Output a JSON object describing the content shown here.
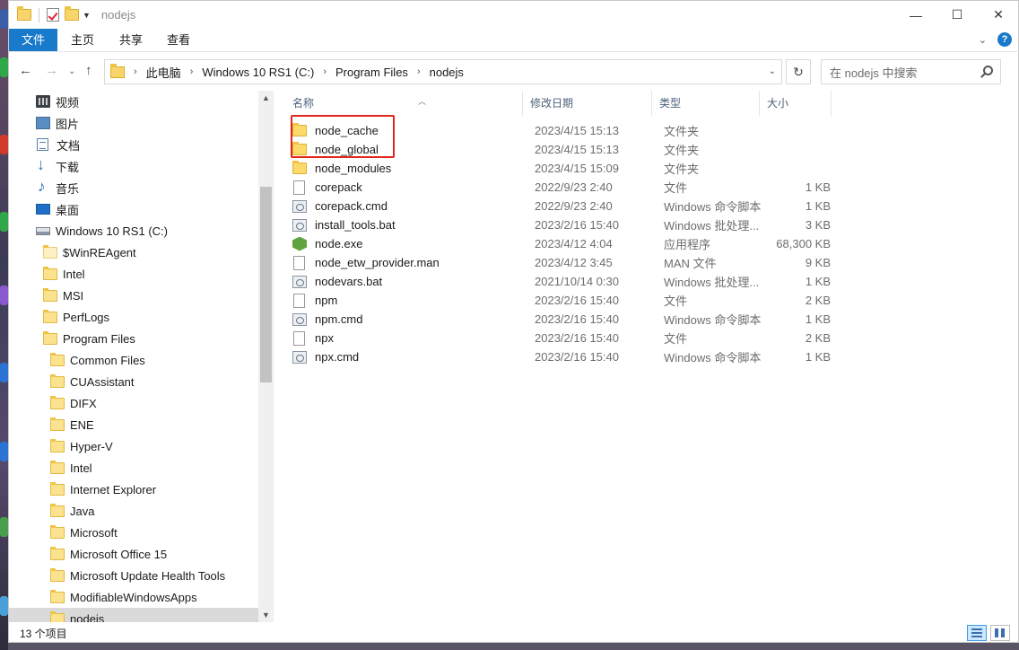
{
  "window": {
    "title": "nodejs",
    "controls": {
      "minimize": "—",
      "maximize": "☐",
      "close": "✕"
    }
  },
  "ribbon": {
    "tabs": [
      "文件",
      "主页",
      "共享",
      "查看"
    ],
    "help": "?"
  },
  "address": {
    "crumbs": [
      "此电脑",
      "Windows 10 RS1 (C:)",
      "Program Files",
      "nodejs"
    ],
    "search_placeholder": "在 nodejs 中搜索"
  },
  "navpane": {
    "items": [
      {
        "label": "视频",
        "icon": "video-icon"
      },
      {
        "label": "图片",
        "icon": "picture-icon"
      },
      {
        "label": "文档",
        "icon": "document-icon"
      },
      {
        "label": "下载",
        "icon": "download-icon"
      },
      {
        "label": "音乐",
        "icon": "music-icon"
      },
      {
        "label": "桌面",
        "icon": "desktop-icon"
      },
      {
        "label": "Windows 10 RS1 (C:)",
        "icon": "drive-icon"
      },
      {
        "label": "$WinREAgent",
        "icon": "folder-icon"
      },
      {
        "label": "Intel",
        "icon": "folder-icon"
      },
      {
        "label": "MSI",
        "icon": "folder-icon"
      },
      {
        "label": "PerfLogs",
        "icon": "folder-icon"
      },
      {
        "label": "Program Files",
        "icon": "folder-icon"
      },
      {
        "label": "Common Files",
        "icon": "folder-icon"
      },
      {
        "label": "CUAssistant",
        "icon": "folder-icon"
      },
      {
        "label": "DIFX",
        "icon": "folder-icon"
      },
      {
        "label": "ENE",
        "icon": "folder-icon"
      },
      {
        "label": "Hyper-V",
        "icon": "folder-icon"
      },
      {
        "label": "Intel",
        "icon": "folder-icon"
      },
      {
        "label": "Internet Explorer",
        "icon": "folder-icon"
      },
      {
        "label": "Java",
        "icon": "folder-icon"
      },
      {
        "label": "Microsoft",
        "icon": "folder-icon"
      },
      {
        "label": "Microsoft Office 15",
        "icon": "folder-icon"
      },
      {
        "label": "Microsoft Update Health Tools",
        "icon": "folder-icon"
      },
      {
        "label": "ModifiableWindowsApps",
        "icon": "folder-icon"
      },
      {
        "label": "nodejs",
        "icon": "folder-icon"
      }
    ]
  },
  "columns": {
    "name": "名称",
    "date": "修改日期",
    "type": "类型",
    "size": "大小"
  },
  "files": [
    {
      "name": "node_cache",
      "date": "2023/4/15 15:13",
      "type": "文件夹",
      "size": "",
      "icon": "folder-icon"
    },
    {
      "name": "node_global",
      "date": "2023/4/15 15:13",
      "type": "文件夹",
      "size": "",
      "icon": "folder-icon"
    },
    {
      "name": "node_modules",
      "date": "2023/4/15 15:09",
      "type": "文件夹",
      "size": "",
      "icon": "folder-icon"
    },
    {
      "name": "corepack",
      "date": "2022/9/23 2:40",
      "type": "文件",
      "size": "1 KB",
      "icon": "file-icon"
    },
    {
      "name": "corepack.cmd",
      "date": "2022/9/23 2:40",
      "type": "Windows 命令脚本",
      "size": "1 KB",
      "icon": "script-icon"
    },
    {
      "name": "install_tools.bat",
      "date": "2023/2/16 15:40",
      "type": "Windows 批处理...",
      "size": "3 KB",
      "icon": "script-icon"
    },
    {
      "name": "node.exe",
      "date": "2023/4/12 4:04",
      "type": "应用程序",
      "size": "68,300 KB",
      "icon": "node-exe-icon"
    },
    {
      "name": "node_etw_provider.man",
      "date": "2023/4/12 3:45",
      "type": "MAN 文件",
      "size": "9 KB",
      "icon": "file-icon"
    },
    {
      "name": "nodevars.bat",
      "date": "2021/10/14 0:30",
      "type": "Windows 批处理...",
      "size": "1 KB",
      "icon": "script-icon"
    },
    {
      "name": "npm",
      "date": "2023/2/16 15:40",
      "type": "文件",
      "size": "2 KB",
      "icon": "file-icon"
    },
    {
      "name": "npm.cmd",
      "date": "2023/2/16 15:40",
      "type": "Windows 命令脚本",
      "size": "1 KB",
      "icon": "script-icon"
    },
    {
      "name": "npx",
      "date": "2023/2/16 15:40",
      "type": "文件",
      "size": "2 KB",
      "icon": "file-icon"
    },
    {
      "name": "npx.cmd",
      "date": "2023/2/16 15:40",
      "type": "Windows 命令脚本",
      "size": "1 KB",
      "icon": "script-icon"
    }
  ],
  "status": {
    "count": "13 个项目"
  },
  "colors": {
    "accent": "#1979ca",
    "highlight": "#e1251b"
  }
}
